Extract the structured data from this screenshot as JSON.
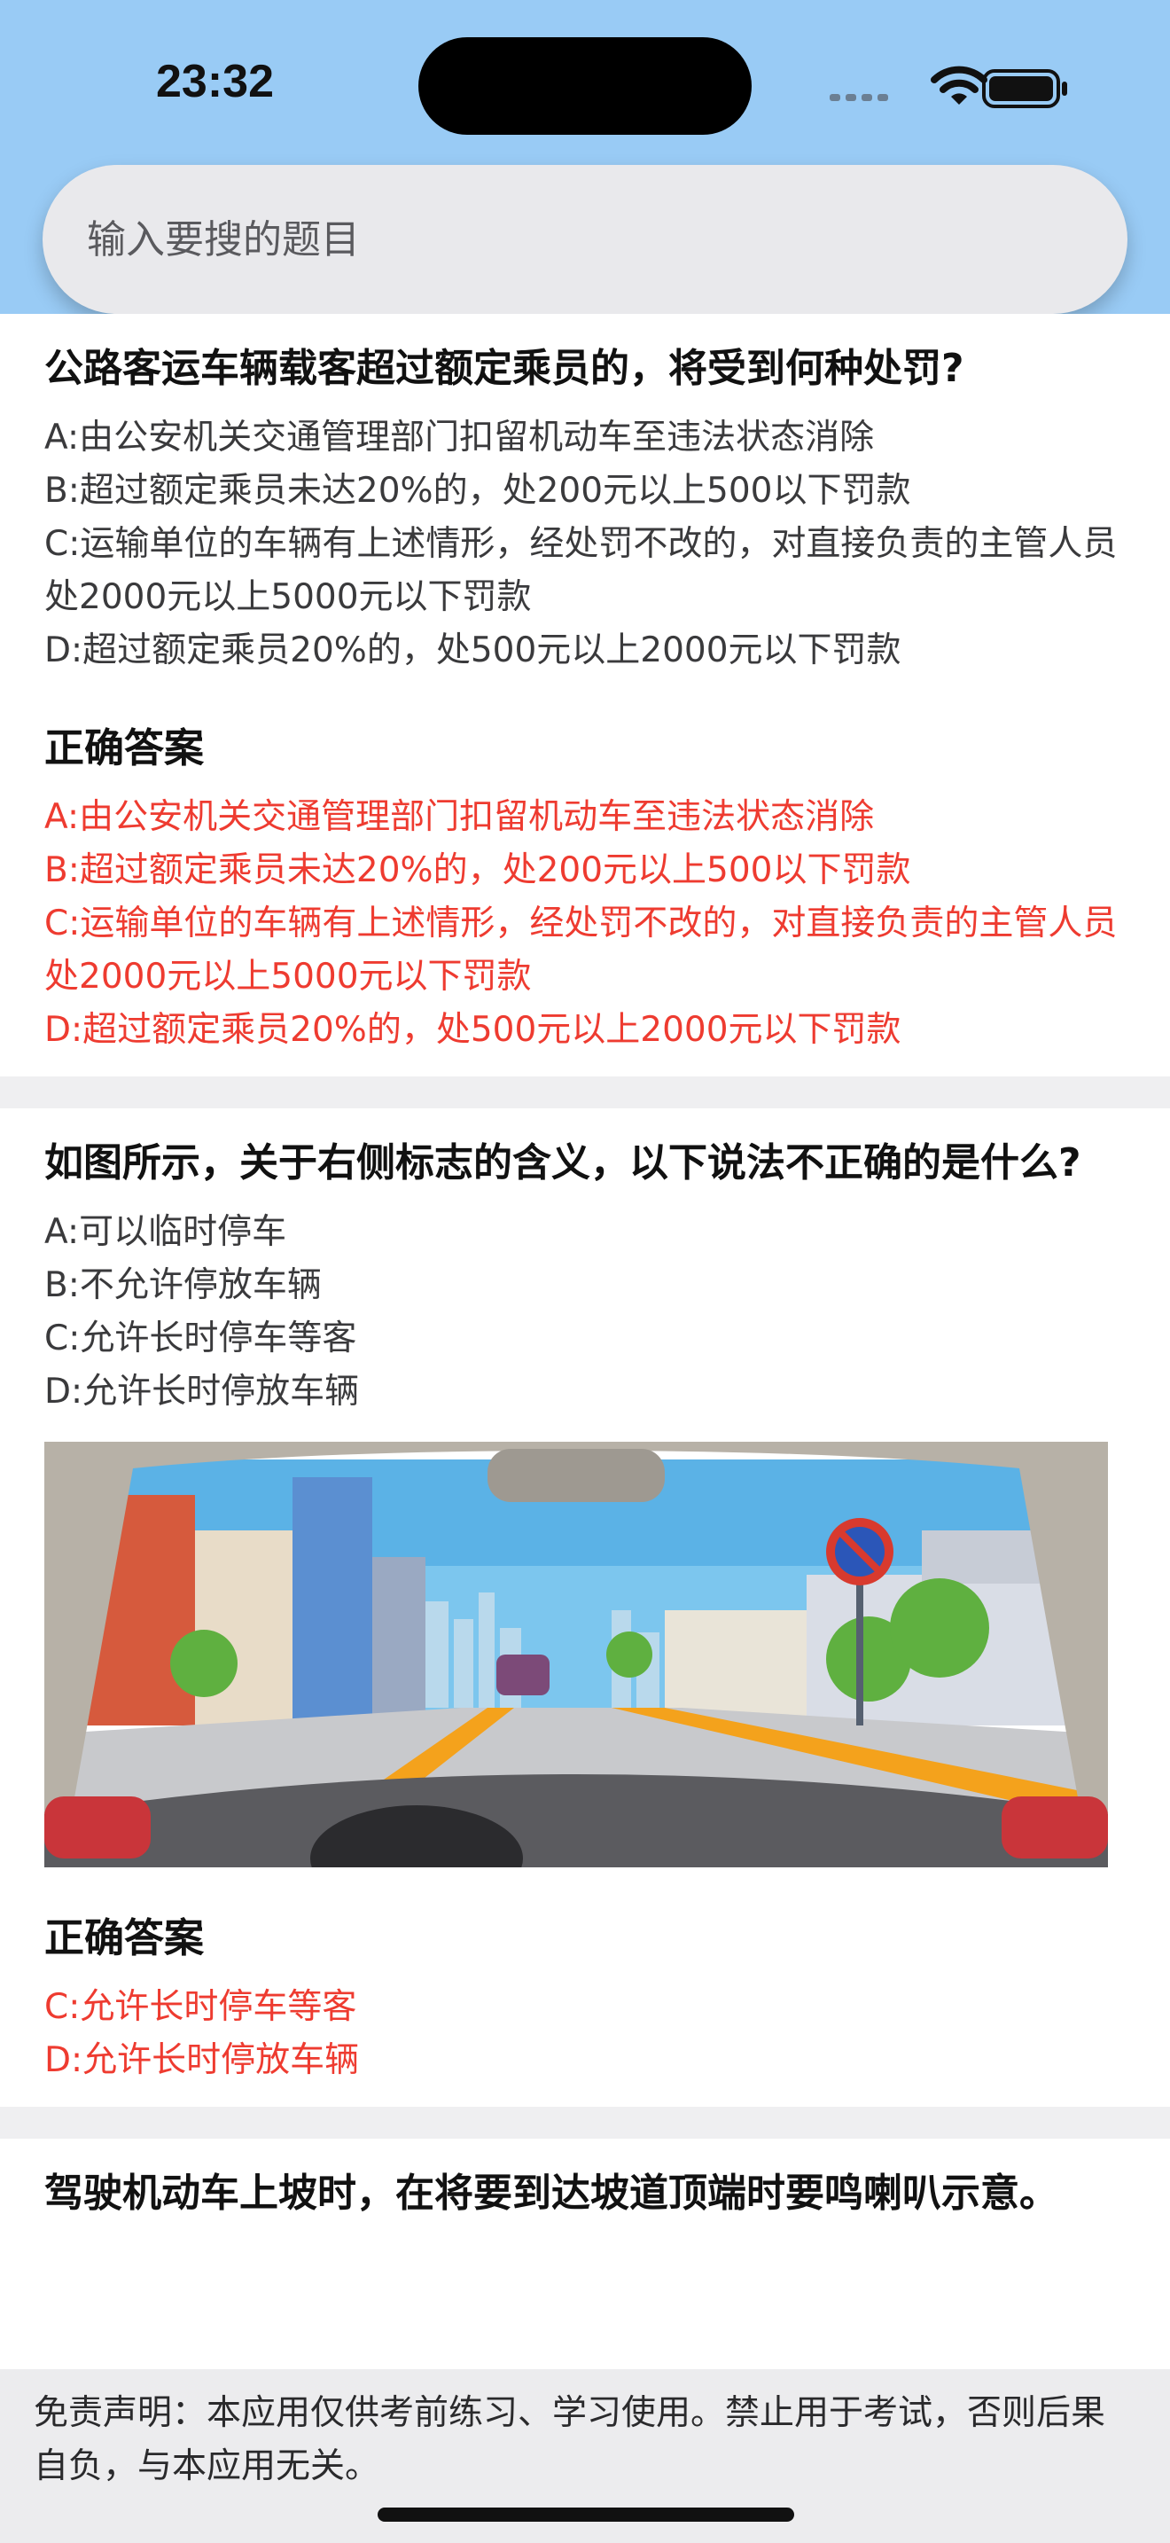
{
  "status_bar": {
    "time": "23:32"
  },
  "search": {
    "placeholder": "输入要搜的题目"
  },
  "questions": [
    {
      "question": "公路客运车辆载客超过额定乘员的，将受到何种处罚?",
      "options": [
        "A:由公安机关交通管理部门扣留机动车至违法状态消除",
        "B:超过额定乘员未达20%的，处200元以上500以下罚款",
        "C:运输单位的车辆有上述情形，经处罚不改的，对直接负责的主管人员处2000元以上5000元以下罚款",
        "D:超过额定乘员20%的，处500元以上2000元以下罚款"
      ],
      "answer_title": "正确答案",
      "answers": [
        "A:由公安机关交通管理部门扣留机动车至违法状态消除",
        "B:超过额定乘员未达20%的，处200元以上500以下罚款",
        "C:运输单位的车辆有上述情形，经处罚不改的，对直接负责的主管人员处2000元以上5000元以下罚款",
        "D:超过额定乘员20%的，处500元以上2000元以下罚款"
      ]
    },
    {
      "question": "如图所示，关于右侧标志的含义，以下说法不正确的是什么?",
      "options": [
        "A:可以临时停车",
        "B:不允许停放车辆",
        "C:允许长时停车等客",
        "D:允许长时停放车辆"
      ],
      "answer_title": "正确答案",
      "answers": [
        "C:允许长时停车等客",
        "D:允许长时停放车辆"
      ]
    },
    {
      "question": "驾驶机动车上坡时，在将要到达坡道顶端时要鸣喇叭示意。"
    }
  ],
  "footer": {
    "disclaimer": "免责声明：本应用仅供考前练习、学习使用。禁止用于考试，否则后果自负，与本应用无关。"
  },
  "colors": {
    "header": "#99cbf5",
    "answer": "#ee3b30"
  }
}
